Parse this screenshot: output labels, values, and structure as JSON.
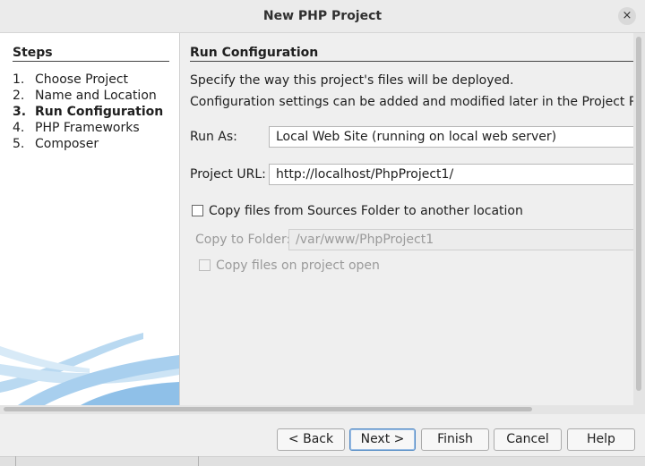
{
  "window": {
    "title": "New PHP Project",
    "close_icon": "×"
  },
  "steps": {
    "title": "Steps",
    "items": [
      {
        "num": "1.",
        "label": "Choose Project"
      },
      {
        "num": "2.",
        "label": "Name and Location"
      },
      {
        "num": "3.",
        "label": "Run Configuration",
        "current": true
      },
      {
        "num": "4.",
        "label": "PHP Frameworks"
      },
      {
        "num": "5.",
        "label": "Composer"
      }
    ]
  },
  "panel": {
    "title": "Run Configuration",
    "desc1": "Specify the way this project's files will be deployed.",
    "desc2": "Configuration settings can be added and modified later in the Project Properties",
    "run_as_label": "Run As:",
    "run_as_value": "Local Web Site (running on local web server)",
    "project_url_label": "Project URL:",
    "project_url_value": "http://localhost/PhpProject1/",
    "copy_files_label": "Copy files from Sources Folder to another location",
    "copy_files_checked": false,
    "copy_to_folder_label": "Copy to Folder:",
    "copy_to_folder_value": "/var/www/PhpProject1",
    "copy_on_open_label": "Copy files on project open",
    "copy_on_open_checked": false
  },
  "buttons": {
    "back": "< Back",
    "next": "Next >",
    "finish": "Finish",
    "cancel": "Cancel",
    "help": "Help"
  },
  "colors": {
    "accent": "#4f88c4",
    "art_blue": "#7fb6e3"
  }
}
